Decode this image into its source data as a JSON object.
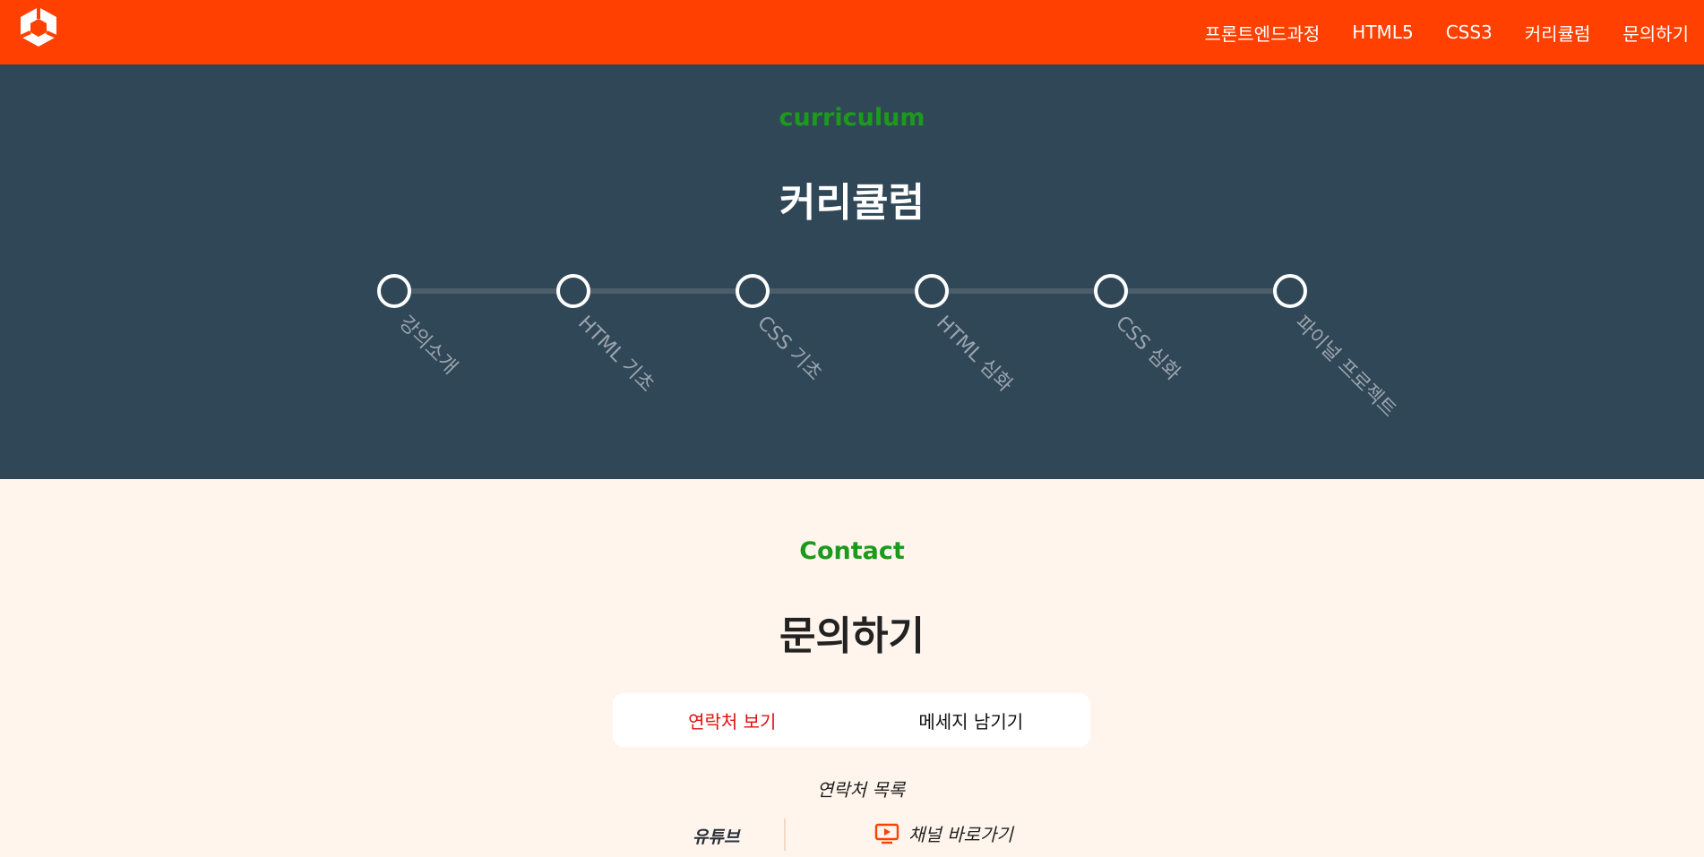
{
  "header": {
    "logo_icon": "cube-logo-icon",
    "nav": [
      "프론트엔드과정",
      "HTML5",
      "CSS3",
      "커리큘럼",
      "문의하기"
    ]
  },
  "curriculum": {
    "subtitle": "curriculum",
    "title": "커리큘럼",
    "steps": [
      "강의소개",
      "HTML 기초",
      "CSS 기초",
      "HTML 심화",
      "CSS 심화",
      "파이널 프로젝트"
    ]
  },
  "contact": {
    "subtitle": "Contact",
    "title": "문의하기",
    "tabs": [
      "연락처 보기",
      "메세지 남기기"
    ],
    "active_tab": 0,
    "list_title": "연락처 목록",
    "rows": [
      {
        "label": "유튜브",
        "icon": "tv-play-icon",
        "link": "채널 바로가기"
      }
    ]
  },
  "colors": {
    "header_bg": "#ff4000",
    "curriculum_bg": "#304758",
    "contact_bg": "#fff5ec",
    "accent_green": "#1c9a1c",
    "active_tab": "#e01010"
  }
}
